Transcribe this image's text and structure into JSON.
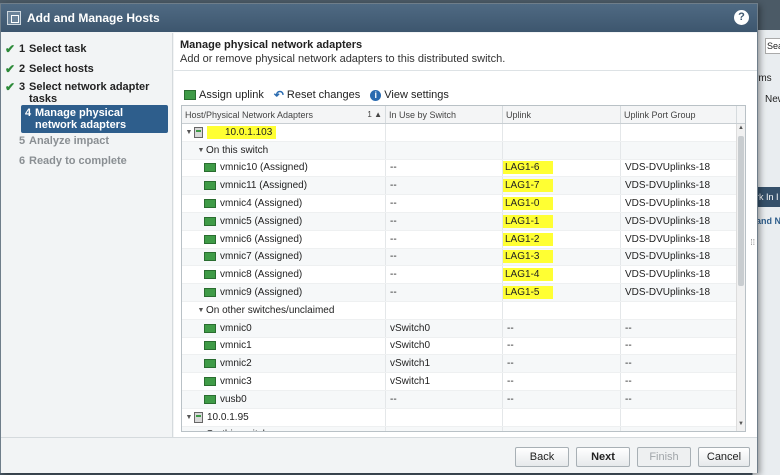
{
  "dialog": {
    "title": "Add and Manage Hosts",
    "help": "?"
  },
  "steps": [
    {
      "num": "1",
      "label": "Select task",
      "state": "done"
    },
    {
      "num": "2",
      "label": "Select hosts",
      "state": "done"
    },
    {
      "num": "3",
      "label": "Select network adapter tasks",
      "state": "done"
    },
    {
      "num": "4",
      "label": "Manage physical network adapters",
      "state": "active"
    },
    {
      "num": "5",
      "label": "Analyze impact",
      "state": "disabled"
    },
    {
      "num": "6",
      "label": "Ready to complete",
      "state": "disabled"
    }
  ],
  "page": {
    "title": "Manage physical network adapters",
    "subtitle": "Add or remove physical network adapters to this distributed switch."
  },
  "toolbar": {
    "assign": "Assign uplink",
    "reset": "Reset changes",
    "view": "View settings"
  },
  "grid": {
    "headers": [
      "Host/Physical Network Adapters",
      "In Use by Switch",
      "Uplink",
      "Uplink Port Group"
    ],
    "sort": "1 ▲",
    "rows": [
      {
        "level": 0,
        "type": "host",
        "name": "10.0.1.103",
        "inuse": "",
        "uplink": "",
        "group": "",
        "hl": true
      },
      {
        "level": 1,
        "type": "group",
        "name": "On this switch",
        "inuse": "",
        "uplink": "",
        "group": ""
      },
      {
        "level": 2,
        "type": "nic",
        "name": "vmnic10 (Assigned)",
        "inuse": "--",
        "uplink": "LAG1-6",
        "group": "VDS-DVUplinks-18"
      },
      {
        "level": 2,
        "type": "nic",
        "name": "vmnic11 (Assigned)",
        "inuse": "--",
        "uplink": "LAG1-7",
        "group": "VDS-DVUplinks-18"
      },
      {
        "level": 2,
        "type": "nic",
        "name": "vmnic4 (Assigned)",
        "inuse": "--",
        "uplink": "LAG1-0",
        "group": "VDS-DVUplinks-18"
      },
      {
        "level": 2,
        "type": "nic",
        "name": "vmnic5 (Assigned)",
        "inuse": "--",
        "uplink": "LAG1-1",
        "group": "VDS-DVUplinks-18"
      },
      {
        "level": 2,
        "type": "nic",
        "name": "vmnic6 (Assigned)",
        "inuse": "--",
        "uplink": "LAG1-2",
        "group": "VDS-DVUplinks-18"
      },
      {
        "level": 2,
        "type": "nic",
        "name": "vmnic7 (Assigned)",
        "inuse": "--",
        "uplink": "LAG1-3",
        "group": "VDS-DVUplinks-18"
      },
      {
        "level": 2,
        "type": "nic",
        "name": "vmnic8 (Assigned)",
        "inuse": "--",
        "uplink": "LAG1-4",
        "group": "VDS-DVUplinks-18"
      },
      {
        "level": 2,
        "type": "nic",
        "name": "vmnic9 (Assigned)",
        "inuse": "--",
        "uplink": "LAG1-5",
        "group": "VDS-DVUplinks-18"
      },
      {
        "level": 1,
        "type": "group",
        "name": "On other switches/unclaimed",
        "inuse": "",
        "uplink": "",
        "group": ""
      },
      {
        "level": 2,
        "type": "nic",
        "name": "vmnic0",
        "inuse": "vSwitch0",
        "uplink": "--",
        "group": "--"
      },
      {
        "level": 2,
        "type": "nic",
        "name": "vmnic1",
        "inuse": "vSwitch0",
        "uplink": "--",
        "group": "--"
      },
      {
        "level": 2,
        "type": "nic",
        "name": "vmnic2",
        "inuse": "vSwitch1",
        "uplink": "--",
        "group": "--"
      },
      {
        "level": 2,
        "type": "nic",
        "name": "vmnic3",
        "inuse": "vSwitch1",
        "uplink": "--",
        "group": "--"
      },
      {
        "level": 2,
        "type": "nic",
        "name": "vusb0",
        "inuse": "--",
        "uplink": "--",
        "group": "--"
      },
      {
        "level": 0,
        "type": "host",
        "name": "10.0.1.95",
        "inuse": "",
        "uplink": "",
        "group": "",
        "hl": false
      },
      {
        "level": 1,
        "type": "group",
        "name": "On this switch",
        "inuse": "",
        "uplink": "",
        "group": ""
      }
    ]
  },
  "buttons": {
    "back": "Back",
    "next": "Next",
    "finish": "Finish",
    "cancel": "Cancel"
  },
  "background": {
    "t1": "Sea",
    "t2": "rms",
    "t3": "New",
    "t4": "rk In I",
    "t5": "and N"
  },
  "colors": {
    "highlight": "#ffff33",
    "active_step": "#2e5e8c",
    "titlebar": "#3d566e",
    "nic_icon": "#3f9b47"
  }
}
